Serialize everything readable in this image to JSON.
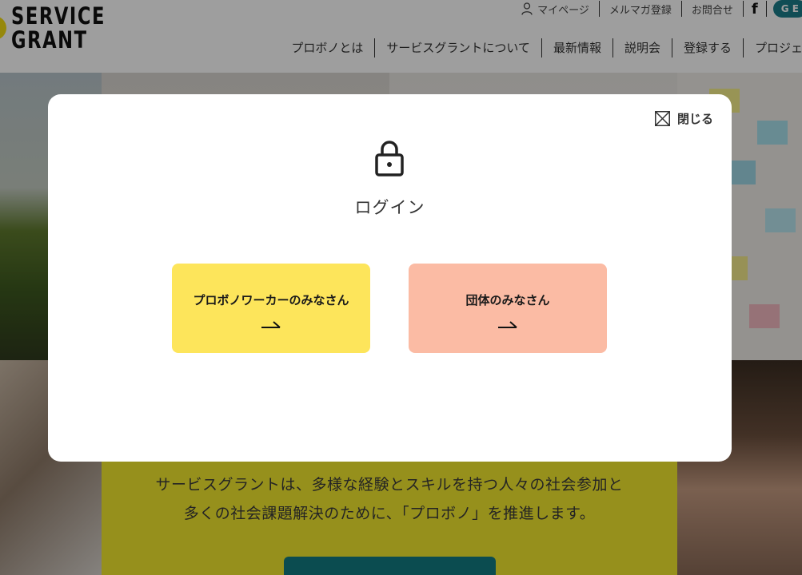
{
  "header": {
    "logo_line1": "SERVICE",
    "logo_line2": "GRANT",
    "util_nav": {
      "mypage": "マイページ",
      "newsletter": "メルマガ登録",
      "contact": "お問合せ",
      "facebook": "f",
      "lang": "G E"
    },
    "main_nav": [
      "プロボノとは",
      "サービスグラントについて",
      "最新情報",
      "説明会",
      "登録する",
      "プロジェク"
    ]
  },
  "hero": {
    "tagline_line1": "サービスグラントは、多様な経験とスキルを持つ人々の社会参加と",
    "tagline_line2": "多くの社会課題解決のために、「プロボノ」を推進します。"
  },
  "modal": {
    "close_label": "閉じる",
    "title": "ログイン",
    "choices": [
      {
        "label": "プロボノワーカーのみなさん",
        "color": "#fde55b"
      },
      {
        "label": "団体のみなさん",
        "color": "#fbbba4"
      }
    ]
  },
  "colors": {
    "brand_yellow": "#f3e92e",
    "teal": "#137b82",
    "overlay": "rgba(0,0,0,0.38)"
  },
  "icons": [
    "person-icon",
    "facebook-icon",
    "close-icon",
    "lock-icon",
    "arrow-right-icon"
  ]
}
